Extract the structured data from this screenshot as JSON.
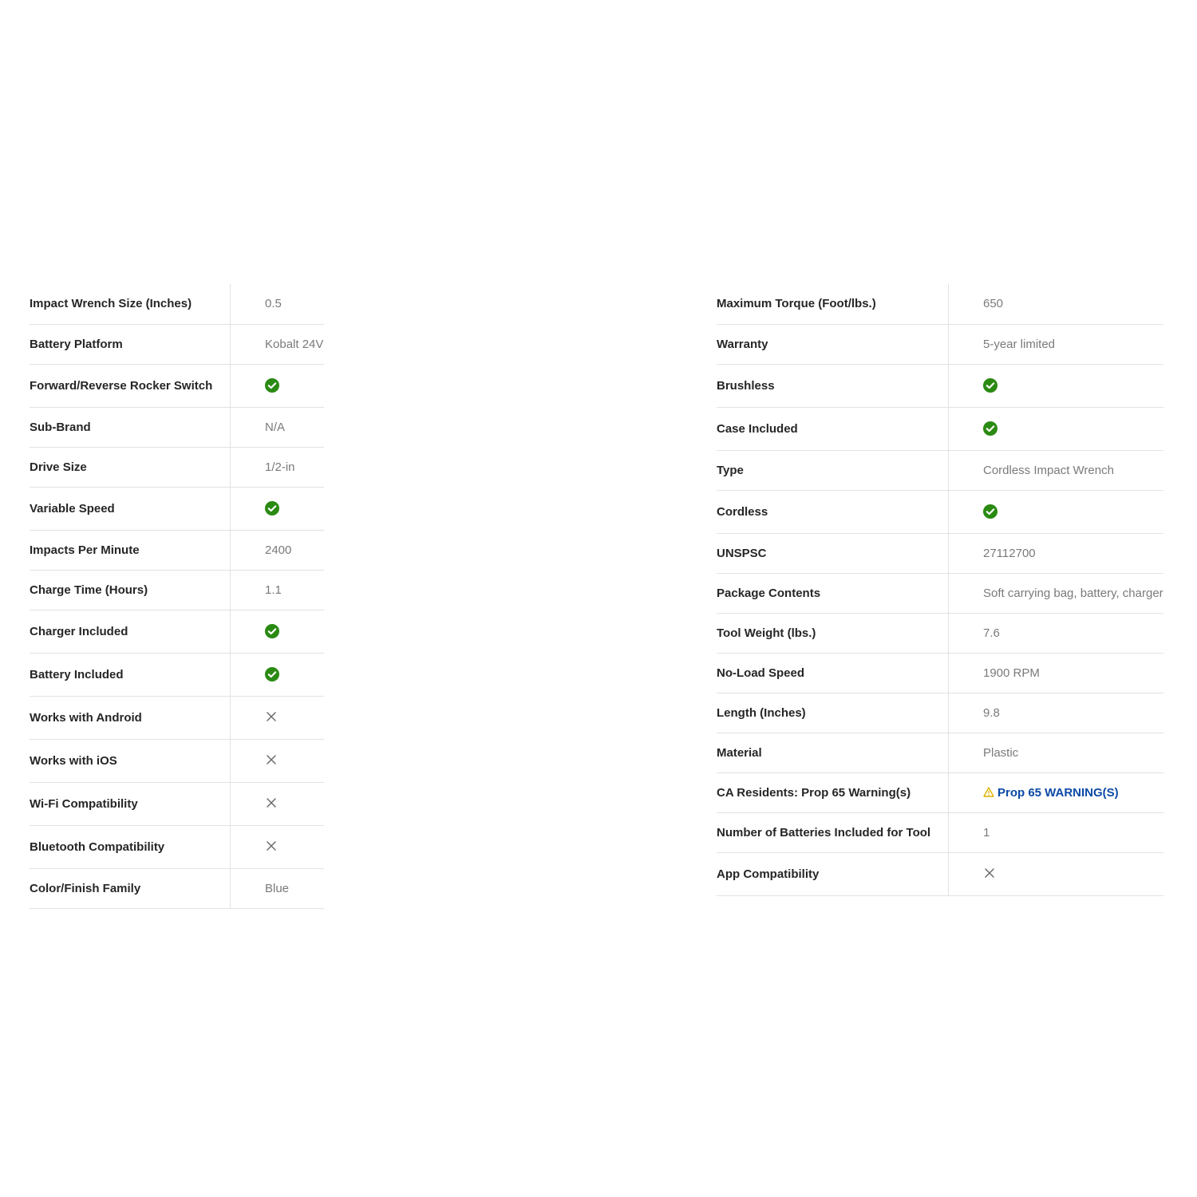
{
  "accent_colors": {
    "check": "#2a8a12",
    "link": "#0b4aa6",
    "warning": "#e0b400"
  },
  "left_specs": [
    {
      "label": "Impact Wrench Size (Inches)",
      "type": "text",
      "value": "0.5"
    },
    {
      "label": "Battery Platform",
      "type": "text",
      "value": "Kobalt 24V"
    },
    {
      "label": "Forward/Reverse Rocker Switch",
      "type": "check",
      "value": "check-icon"
    },
    {
      "label": "Sub-Brand",
      "type": "text",
      "value": "N/A"
    },
    {
      "label": "Drive Size",
      "type": "text",
      "value": "1/2-in"
    },
    {
      "label": "Variable Speed",
      "type": "check",
      "value": "check-icon"
    },
    {
      "label": "Impacts Per Minute",
      "type": "text",
      "value": "2400"
    },
    {
      "label": "Charge Time (Hours)",
      "type": "text",
      "value": "1.1"
    },
    {
      "label": "Charger Included",
      "type": "check",
      "value": "check-icon"
    },
    {
      "label": "Battery Included",
      "type": "check",
      "value": "check-icon"
    },
    {
      "label": "Works with Android",
      "type": "x",
      "value": "x-icon"
    },
    {
      "label": "Works with iOS",
      "type": "x",
      "value": "x-icon"
    },
    {
      "label": "Wi-Fi Compatibility",
      "type": "x",
      "value": "x-icon"
    },
    {
      "label": "Bluetooth Compatibility",
      "type": "x",
      "value": "x-icon"
    },
    {
      "label": "Color/Finish Family",
      "type": "text",
      "value": "Blue"
    }
  ],
  "right_specs": [
    {
      "label": "Maximum Torque (Foot/lbs.)",
      "type": "text",
      "value": "650"
    },
    {
      "label": "Warranty",
      "type": "text",
      "value": "5-year limited"
    },
    {
      "label": "Brushless",
      "type": "check",
      "value": "check-icon"
    },
    {
      "label": "Case Included",
      "type": "check",
      "value": "check-icon"
    },
    {
      "label": "Type",
      "type": "text",
      "value": "Cordless Impact Wrench"
    },
    {
      "label": "Cordless",
      "type": "check",
      "value": "check-icon"
    },
    {
      "label": "UNSPSC",
      "type": "text",
      "value": "27112700"
    },
    {
      "label": "Package Contents",
      "type": "text",
      "value": "Soft carrying bag, battery, charger"
    },
    {
      "label": "Tool Weight (lbs.)",
      "type": "text",
      "value": "7.6"
    },
    {
      "label": "No-Load Speed",
      "type": "text",
      "value": "1900 RPM"
    },
    {
      "label": "Length (Inches)",
      "type": "text",
      "value": "9.8"
    },
    {
      "label": "Material",
      "type": "text",
      "value": "Plastic"
    },
    {
      "label": "CA Residents: Prop 65 Warning(s)",
      "type": "link",
      "value": "Prop 65 WARNING(S)"
    },
    {
      "label": "Number of Batteries Included for Tool",
      "type": "text",
      "value": "1"
    },
    {
      "label": "App Compatibility",
      "type": "x",
      "value": "x-icon"
    }
  ]
}
